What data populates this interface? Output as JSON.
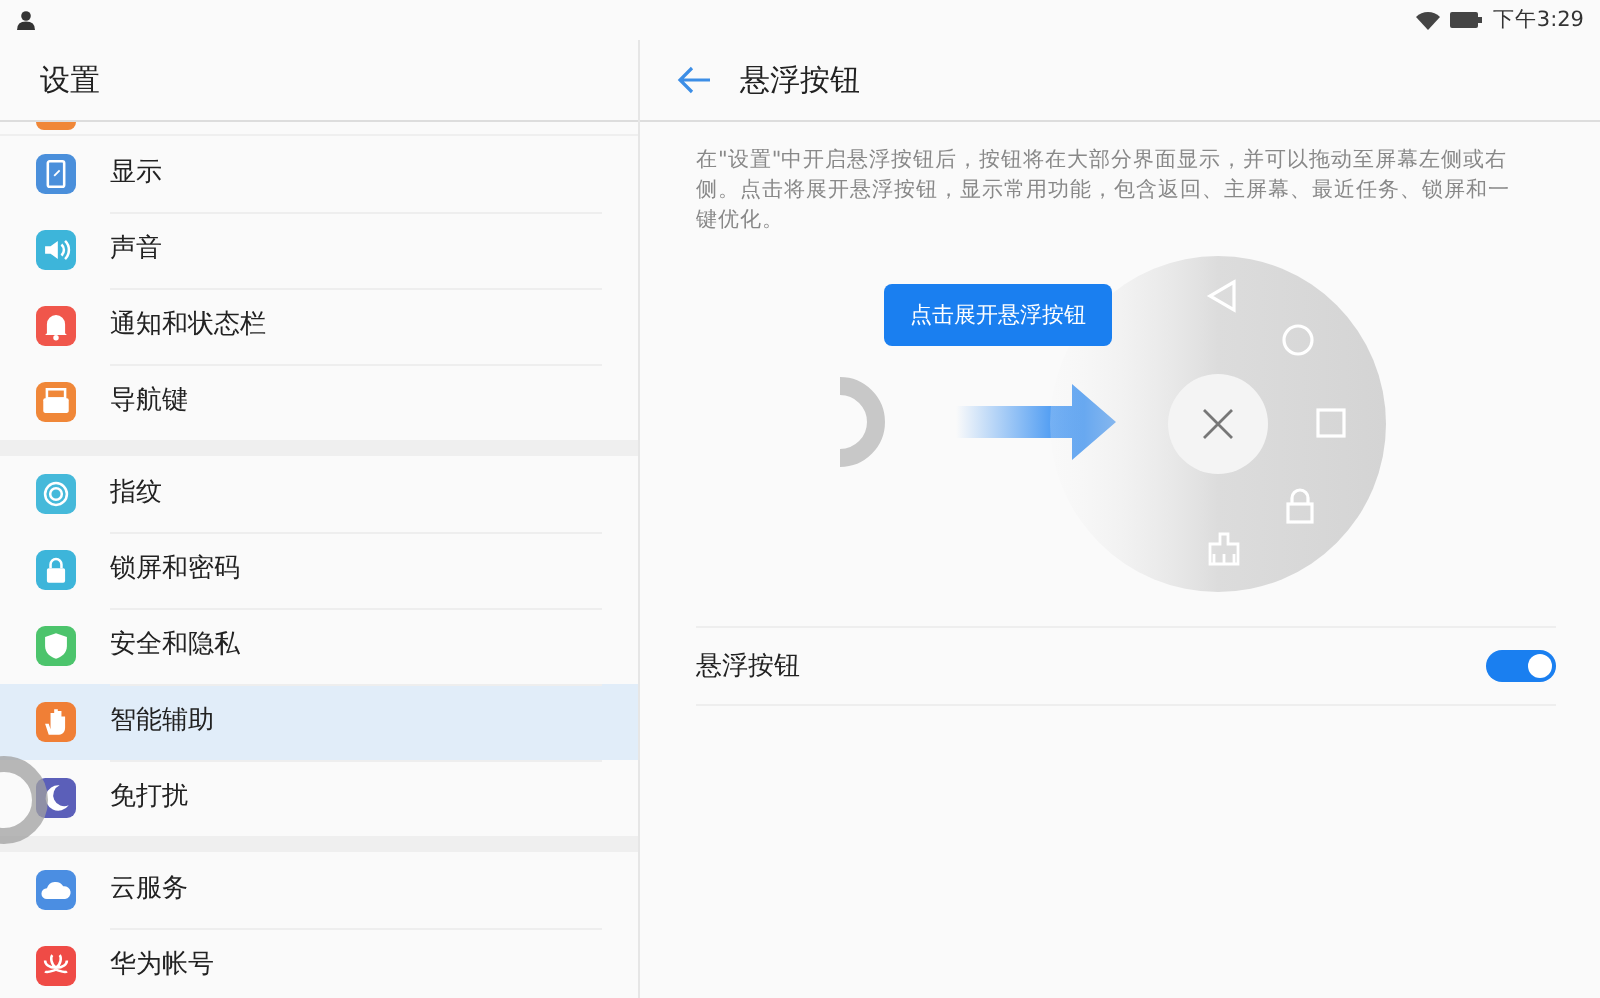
{
  "status_bar": {
    "time": "下午3:29"
  },
  "sidebar": {
    "title": "设置",
    "groups": [
      {
        "items": [
          {
            "label": "显示",
            "color": "#4a8fdb",
            "selected": false
          },
          {
            "label": "声音",
            "color": "#3db5da",
            "selected": false
          },
          {
            "label": "通知和状态栏",
            "color": "#f0564b",
            "selected": false
          },
          {
            "label": "导航键",
            "color": "#f08738",
            "selected": false
          }
        ]
      },
      {
        "items": [
          {
            "label": "指纹",
            "color": "#45b9da",
            "selected": false
          },
          {
            "label": "锁屏和密码",
            "color": "#3db5da",
            "selected": false
          },
          {
            "label": "安全和隐私",
            "color": "#4cc46c",
            "selected": false
          },
          {
            "label": "智能辅助",
            "color": "#f07f36",
            "selected": true
          },
          {
            "label": "免打扰",
            "color": "#5b5fb9",
            "selected": false
          }
        ]
      },
      {
        "items": [
          {
            "label": "云服务",
            "color": "#4b8ee2",
            "selected": false
          },
          {
            "label": "华为帐号",
            "color": "#ef4b46",
            "selected": false
          }
        ]
      }
    ]
  },
  "detail": {
    "title": "悬浮按钮",
    "description": "在\"设置\"中开启悬浮按钮后，按钮将在大部分界面显示，并可以拖动至屏幕左侧或右侧。点击将展开悬浮按钮，显示常用功能，包含返回、主屏幕、最近任务、锁屏和一键优化。",
    "illustration": {
      "tooltip": "点击展开悬浮按钮"
    },
    "settings": [
      {
        "label": "悬浮按钮",
        "on": true
      }
    ]
  }
}
